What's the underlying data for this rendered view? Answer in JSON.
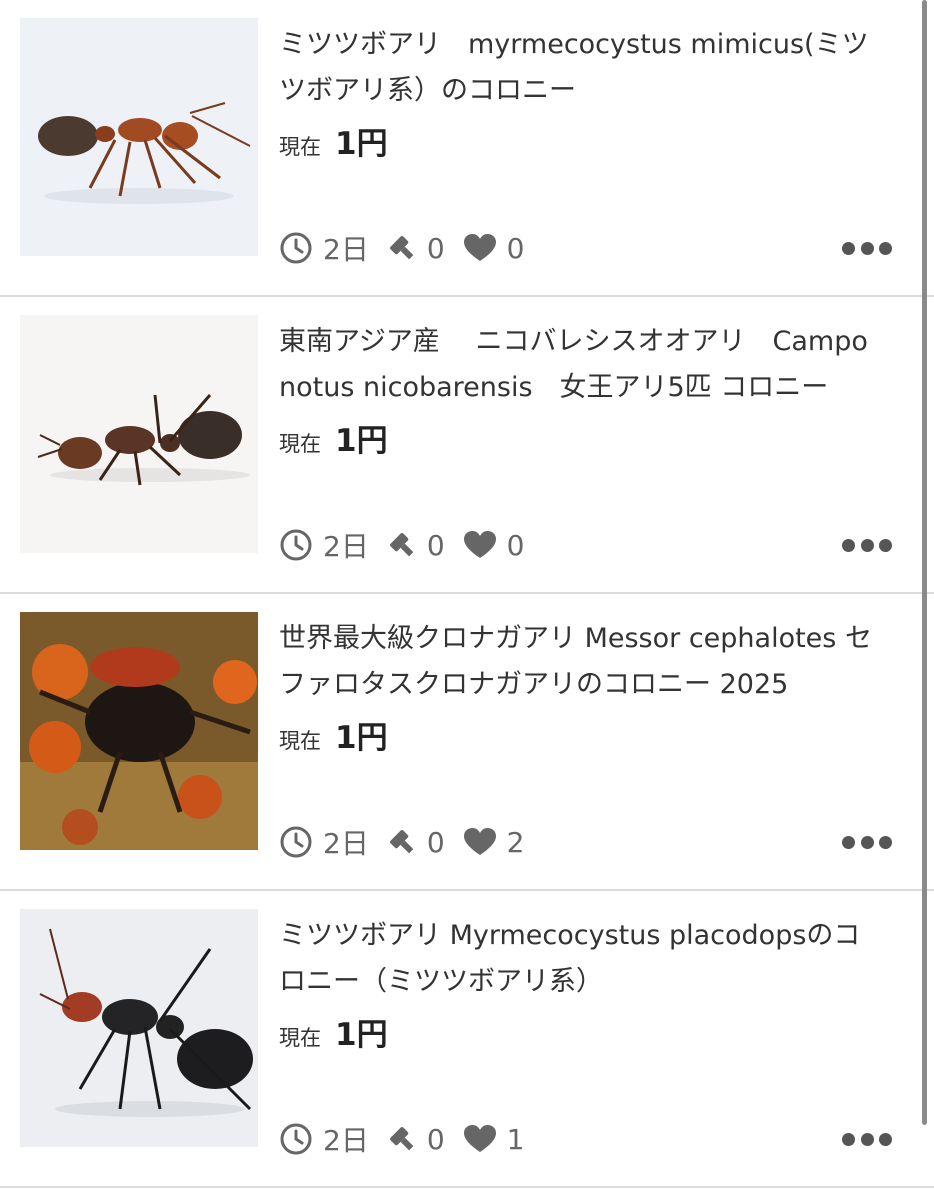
{
  "listings": [
    {
      "title": "ミツツボアリ　myrmecocystus mimicus(ミツツボアリ系）のコロニー",
      "price_label": "現在",
      "price": "1円",
      "time_left": "2日",
      "bids": "0",
      "watchers": "0",
      "image_icon": "ant-photo"
    },
    {
      "title": "東南アジア産　 ニコバレシスオオアリ　Camponotus nicobarensis　女王アリ5匹 コロニー",
      "price_label": "現在",
      "price": "1円",
      "time_left": "2日",
      "bids": "0",
      "watchers": "0",
      "image_icon": "ant-photo"
    },
    {
      "title": "世界最大級クロナガアリ Messor cephalotes セファロタスクロナガアリのコロニー 2025",
      "price_label": "現在",
      "price": "1円",
      "time_left": "2日",
      "bids": "0",
      "watchers": "2",
      "image_icon": "ant-colony-photo"
    },
    {
      "title": "ミツツボアリ Myrmecocystus placodopsのコロニー（ミツツボアリ系）",
      "price_label": "現在",
      "price": "1円",
      "time_left": "2日",
      "bids": "0",
      "watchers": "1",
      "image_icon": "ant-photo"
    }
  ],
  "icons": {
    "time": "clock-icon",
    "bids": "gavel-icon",
    "watch": "heart-icon",
    "more": "more-dots-icon"
  },
  "colors": {
    "text": "#333333",
    "meta": "#666666",
    "divider": "#dcdcdc"
  }
}
